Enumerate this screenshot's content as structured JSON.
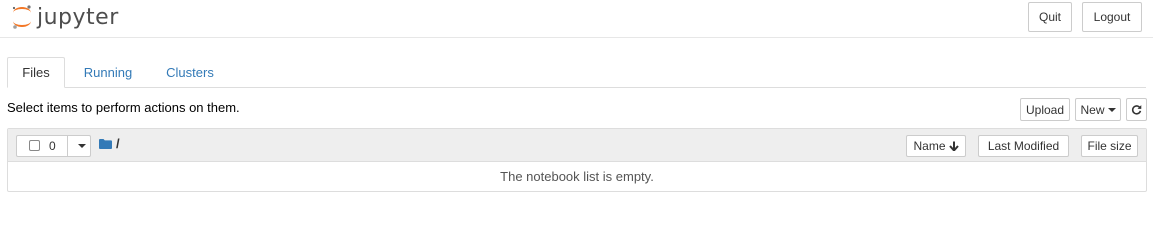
{
  "header": {
    "logo_text": "jupyter",
    "quit_label": "Quit",
    "logout_label": "Logout",
    "brand_color": "#F37726"
  },
  "tabs": [
    {
      "label": "Files",
      "active": true
    },
    {
      "label": "Running",
      "active": false
    },
    {
      "label": "Clusters",
      "active": false
    }
  ],
  "toolbar": {
    "instructions": "Select items to perform actions on them.",
    "upload_label": "Upload",
    "new_label": "New",
    "refresh_icon": "refresh-icon"
  },
  "file_list": {
    "selected_count": "0",
    "breadcrumb_root": "/",
    "columns": {
      "name": "Name",
      "last_modified": "Last Modified",
      "file_size": "File size"
    },
    "empty_message": "The notebook list is empty."
  }
}
